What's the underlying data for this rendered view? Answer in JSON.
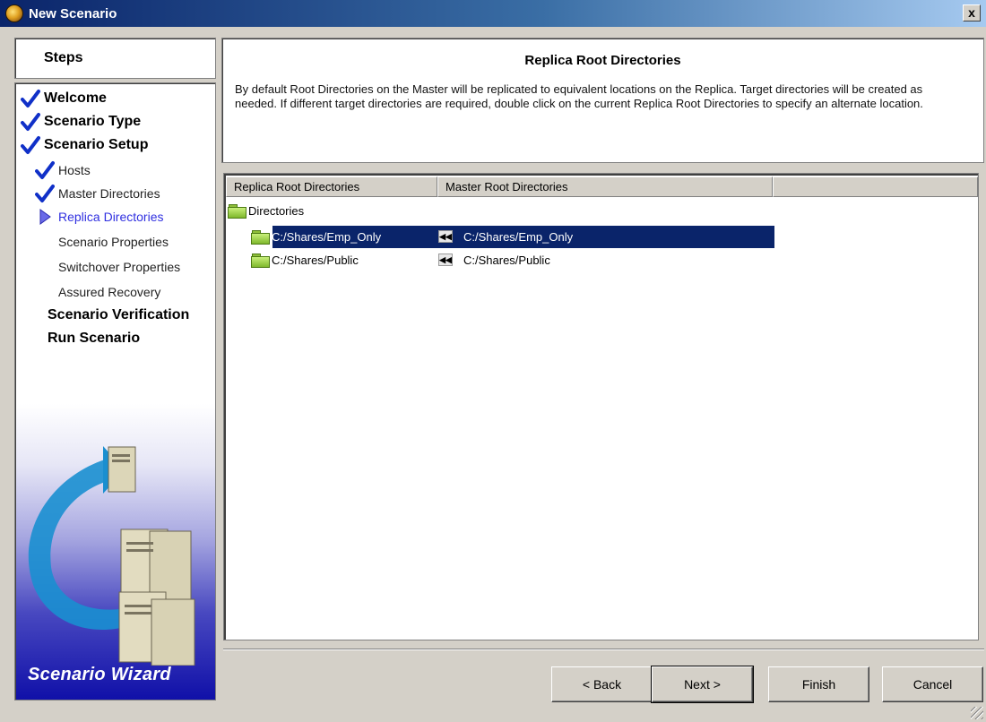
{
  "window": {
    "title": "New Scenario",
    "close_label": "x"
  },
  "steps": {
    "header": "Steps",
    "items": [
      {
        "label": "Welcome",
        "level": 1,
        "done": true
      },
      {
        "label": "Scenario Type",
        "level": 1,
        "done": true
      },
      {
        "label": "Scenario Setup",
        "level": 1,
        "done": true
      },
      {
        "label": "Hosts",
        "level": 2,
        "done": true
      },
      {
        "label": "Master Directories",
        "level": 2,
        "done": true
      },
      {
        "label": "Replica Directories",
        "level": 2,
        "current": true
      },
      {
        "label": "Scenario Properties",
        "level": 2
      },
      {
        "label": "Switchover Properties",
        "level": 2
      },
      {
        "label": "Assured Recovery",
        "level": 2
      },
      {
        "label": "Scenario Verification",
        "level": 1
      },
      {
        "label": "Run Scenario",
        "level": 1
      }
    ],
    "caption": "Scenario Wizard"
  },
  "description": {
    "title": "Replica Root Directories",
    "text": "By default Root Directories on the Master will be replicated to equivalent locations on the Replica.  Target directories will be created as needed. If different target directories are required, double click on the current Replica Root Directories to specify an alternate location."
  },
  "directory_list": {
    "columns": [
      "Replica Root Directories",
      "Master Root Directories"
    ],
    "root_label": "Directories",
    "rows": [
      {
        "replica": "C:/Shares/Emp_Only",
        "master": "C:/Shares/Emp_Only",
        "selected": true
      },
      {
        "replica": "C:/Shares/Public",
        "master": "C:/Shares/Public",
        "selected": false
      }
    ]
  },
  "buttons": {
    "back": "< Back",
    "next": "Next >",
    "finish": "Finish",
    "cancel": "Cancel"
  },
  "colors": {
    "title_bar": "#0a246a",
    "selection": "#0a246a",
    "current_step": "#3030e0",
    "check": "#1030c8"
  }
}
